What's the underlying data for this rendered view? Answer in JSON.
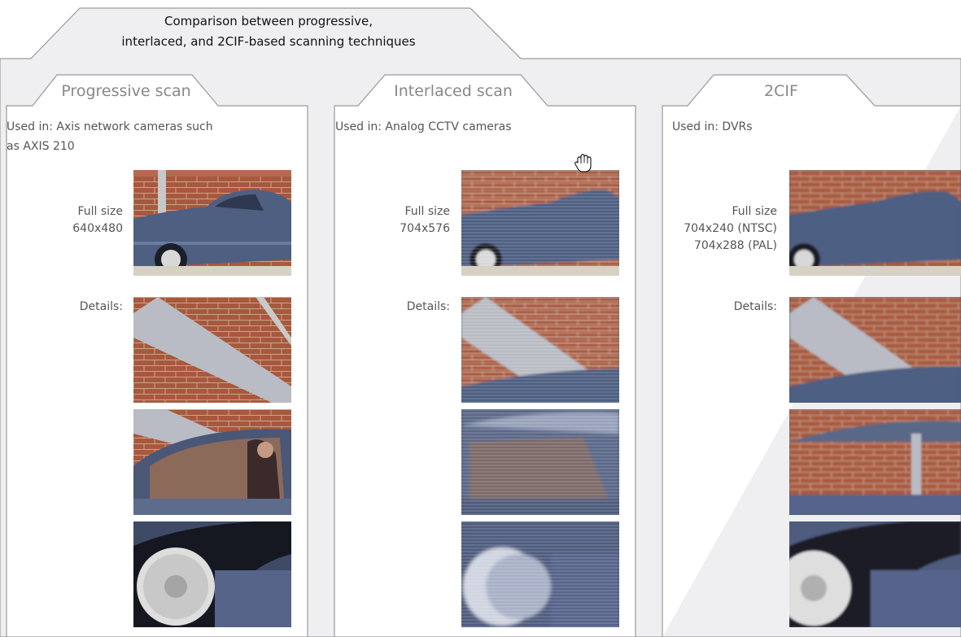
{
  "header": {
    "title_line1": "Comparison between progressive,",
    "title_line2": "interlaced, and 2CIF-based scanning techniques"
  },
  "columns": [
    {
      "id": "progressive",
      "title": "Progressive scan",
      "used_in": [
        "Used in: Axis network cameras such",
        "as AXIS 210"
      ],
      "full_size_label": "Full size",
      "sizes": [
        "640x480"
      ],
      "details_label": "Details:"
    },
    {
      "id": "interlaced",
      "title": "Interlaced scan",
      "used_in": [
        "Used in: Analog CCTV cameras"
      ],
      "full_size_label": "Full size",
      "sizes": [
        "704x576"
      ],
      "details_label": "Details:"
    },
    {
      "id": "2cif",
      "title": "2CIF",
      "used_in": [
        "Used in: DVRs"
      ],
      "full_size_label": "Full size",
      "sizes": [
        "704x240 (NTSC)",
        "704x288 (PAL)"
      ],
      "details_label": "Details:"
    }
  ],
  "colors": {
    "panel_bg": "#efeff1",
    "border": "#999999",
    "brick": "#a8583d",
    "car_blue": "#4e5f82",
    "text": "#555555"
  },
  "icons": {
    "cursor": "hand-pointer-icon"
  }
}
